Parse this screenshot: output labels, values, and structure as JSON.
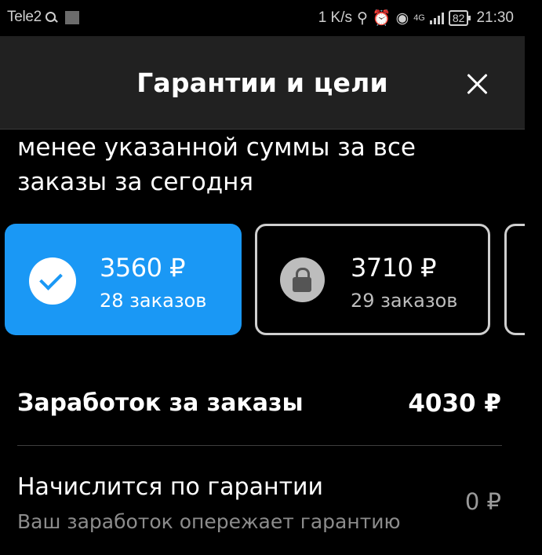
{
  "status_bar": {
    "carrier": "Tele2",
    "speed": "1 K/s",
    "network": "4G",
    "battery": "82",
    "time": "21:30"
  },
  "header": {
    "title": "Гарантии и цели"
  },
  "description": {
    "line1": "менее указанной суммы за все",
    "line2": "заказы за сегодня"
  },
  "goals": [
    {
      "amount": "3560 ₽",
      "orders": "28 заказов",
      "state": "achieved",
      "icon": "check-icon"
    },
    {
      "amount": "3710 ₽",
      "orders": "29 заказов",
      "state": "locked",
      "icon": "lock-icon"
    }
  ],
  "earnings": {
    "label": "Заработок за заказы",
    "value": "4030 ₽"
  },
  "guarantee": {
    "label": "Начислится по гарантии",
    "subtitle": "Ваш заработок опережает гарантию",
    "value": "0 ₽"
  },
  "colors": {
    "accent": "#1a98f5",
    "background": "#000000",
    "header_bg": "#212121"
  }
}
